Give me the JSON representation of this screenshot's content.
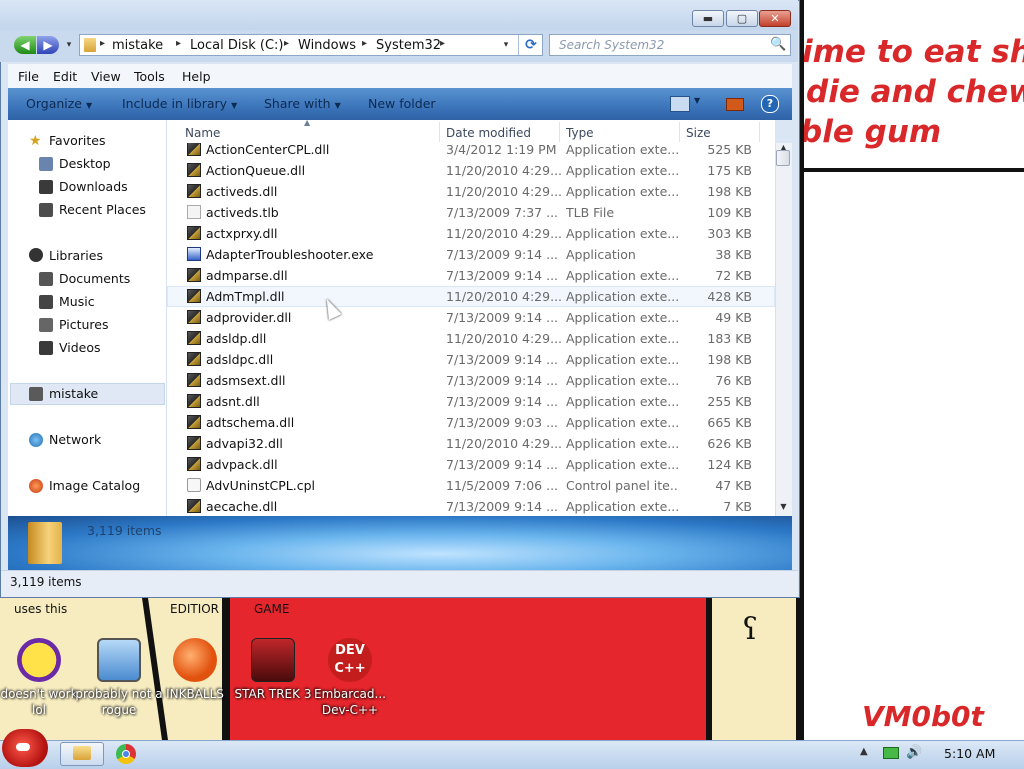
{
  "desktop": {
    "wallpaper_text": [
      "ime to eat shit",
      "die and chew",
      "ble gum"
    ],
    "wallpaper_signature": "VM0b0t",
    "labels_top": [
      "uses this",
      "EDITIOR",
      "GAME"
    ],
    "icons": [
      {
        "label": "doesn't work lol",
        "icon": "yahoo-messenger-icon"
      },
      {
        "label": "probably not a rogue",
        "icon": "monitor-gears-icon"
      },
      {
        "label": "INKBALLS",
        "icon": "inkballs-icon"
      },
      {
        "label": "STAR TREK 3",
        "icon": "star-wars-game-icon"
      },
      {
        "label": "Embarcad... Dev-C++",
        "icon": "dev-cpp-icon"
      }
    ]
  },
  "window": {
    "title_buttons": {
      "minimize": "▬",
      "maximize": "▢",
      "close": "✕"
    },
    "nav": {
      "back": "◀",
      "forward": "▶",
      "recent": "▾"
    },
    "breadcrumbs": [
      "mistake",
      "Local Disk (C:)",
      "Windows",
      "System32"
    ],
    "crumb_separator": "▸",
    "address_dropdown": "▾",
    "refresh": "⟳",
    "search": {
      "placeholder": "Search System32",
      "icon": "🔍"
    },
    "menu": [
      "File",
      "Edit",
      "View",
      "Tools",
      "Help"
    ],
    "toolbar": {
      "organize": "Organize",
      "include_in_library": "Include in library",
      "share_with": "Share with",
      "new_folder": "New folder",
      "dropdown_arrow": "▼",
      "help": "?"
    },
    "nav_pane": {
      "favorites": "Favorites",
      "favorites_items": [
        "Desktop",
        "Downloads",
        "Recent Places"
      ],
      "libraries": "Libraries",
      "libraries_items": [
        "Documents",
        "Music",
        "Pictures",
        "Videos"
      ],
      "homegroup": "mistake",
      "network": "Network",
      "image_catalog": "Image Catalog"
    },
    "columns": {
      "name": "Name",
      "date_modified": "Date modified",
      "type": "Type",
      "size": "Size",
      "sort_indicator": "▲"
    },
    "files": [
      {
        "name": "ActionCenterCPL.dll",
        "date": "3/4/2012 1:19 PM",
        "type": "Application exte...",
        "size": "525 KB",
        "icon": "dll"
      },
      {
        "name": "ActionQueue.dll",
        "date": "11/20/2010 4:29...",
        "type": "Application exte...",
        "size": "175 KB",
        "icon": "dll"
      },
      {
        "name": "activeds.dll",
        "date": "11/20/2010 4:29...",
        "type": "Application exte...",
        "size": "198 KB",
        "icon": "dll"
      },
      {
        "name": "activeds.tlb",
        "date": "7/13/2009 7:37 ...",
        "type": "TLB File",
        "size": "109 KB",
        "icon": "tlb"
      },
      {
        "name": "actxprxy.dll",
        "date": "11/20/2010 4:29...",
        "type": "Application exte...",
        "size": "303 KB",
        "icon": "dll"
      },
      {
        "name": "AdapterTroubleshooter.exe",
        "date": "7/13/2009 9:14 ...",
        "type": "Application",
        "size": "38 KB",
        "icon": "exe"
      },
      {
        "name": "admparse.dll",
        "date": "7/13/2009 9:14 ...",
        "type": "Application exte...",
        "size": "72 KB",
        "icon": "dll"
      },
      {
        "name": "AdmTmpl.dll",
        "date": "11/20/2010 4:29...",
        "type": "Application exte...",
        "size": "428 KB",
        "icon": "dll"
      },
      {
        "name": "adprovider.dll",
        "date": "7/13/2009 9:14 ...",
        "type": "Application exte...",
        "size": "49 KB",
        "icon": "dll"
      },
      {
        "name": "adsldp.dll",
        "date": "11/20/2010 4:29...",
        "type": "Application exte...",
        "size": "183 KB",
        "icon": "dll"
      },
      {
        "name": "adsldpc.dll",
        "date": "7/13/2009 9:14 ...",
        "type": "Application exte...",
        "size": "198 KB",
        "icon": "dll"
      },
      {
        "name": "adsmsext.dll",
        "date": "7/13/2009 9:14 ...",
        "type": "Application exte...",
        "size": "76 KB",
        "icon": "dll"
      },
      {
        "name": "adsnt.dll",
        "date": "7/13/2009 9:14 ...",
        "type": "Application exte...",
        "size": "255 KB",
        "icon": "dll"
      },
      {
        "name": "adtschema.dll",
        "date": "7/13/2009 9:03 ...",
        "type": "Application exte...",
        "size": "665 KB",
        "icon": "dll"
      },
      {
        "name": "advapi32.dll",
        "date": "11/20/2010 4:29...",
        "type": "Application exte...",
        "size": "626 KB",
        "icon": "dll"
      },
      {
        "name": "advpack.dll",
        "date": "7/13/2009 9:14 ...",
        "type": "Application exte...",
        "size": "124 KB",
        "icon": "dll"
      },
      {
        "name": "AdvUninstCPL.cpl",
        "date": "11/5/2009 7:06 ...",
        "type": "Control panel ite...",
        "size": "47 KB",
        "icon": "cpl"
      },
      {
        "name": "aecache.dll",
        "date": "7/13/2009 9:14 ...",
        "type": "Application exte...",
        "size": "7 KB",
        "icon": "dll"
      }
    ],
    "hovered_file": "AdmTmpl.dll",
    "details_count": "3,119 items",
    "status_text": "3,119 items",
    "scroll": {
      "up": "▲",
      "down": "▼"
    }
  },
  "taskbar": {
    "tray_arrow": "▲",
    "volume": "🔊",
    "clock": "5:10 AM"
  },
  "colors": {
    "toolbar_blue": "#3e77bc",
    "wallpaper_red": "#e5262c",
    "wallpaper_yellow": "#f6ecc0",
    "text_red": "#d8282a"
  }
}
